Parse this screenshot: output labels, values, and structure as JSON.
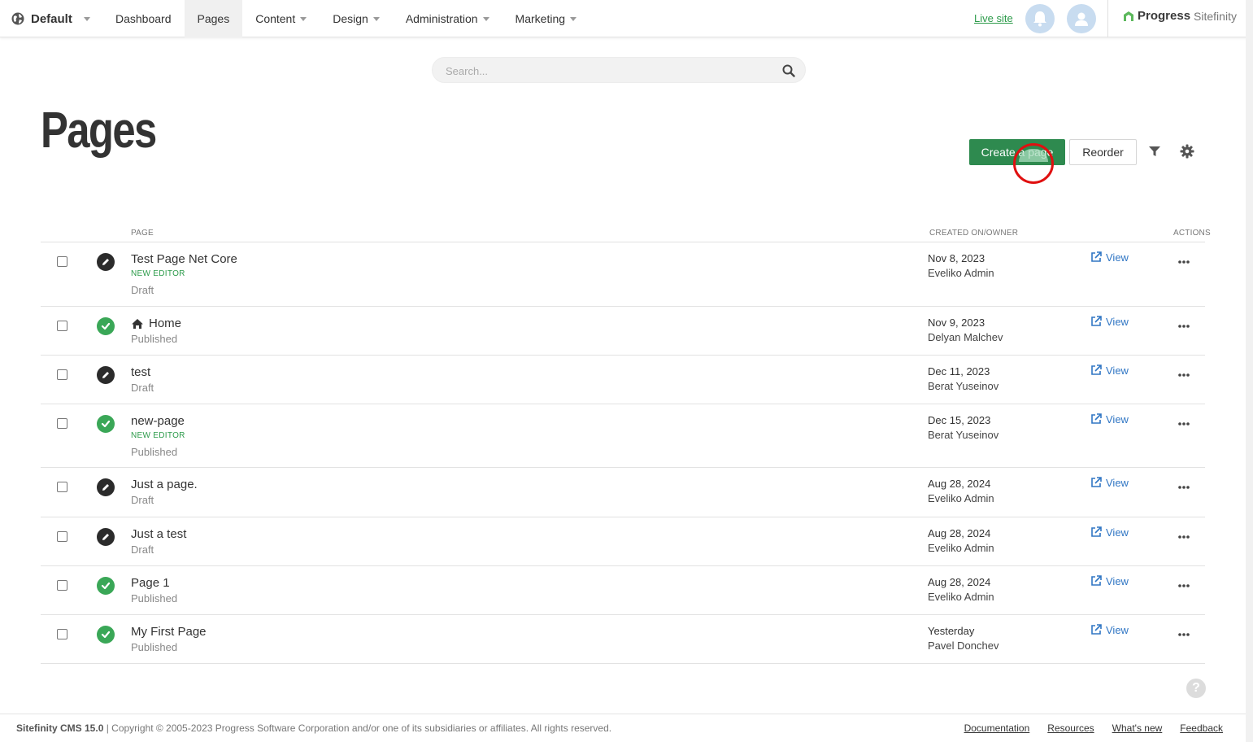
{
  "header": {
    "site_name": "Default",
    "nav": [
      "Dashboard",
      "Pages",
      "Content",
      "Design",
      "Administration",
      "Marketing"
    ],
    "active_nav": "Pages",
    "live_site": "Live site",
    "brand": {
      "progress": "Progress",
      "sitefinity": "Sitefinity"
    }
  },
  "search": {
    "placeholder": "Search..."
  },
  "page_title": "Pages",
  "toolbar": {
    "create_label": "Create a page",
    "reorder_label": "Reorder"
  },
  "table": {
    "col_page": "PAGE",
    "col_created": "CREATED ON/OWNER",
    "col_actions": "ACTIONS",
    "view_label": "View",
    "rows": [
      {
        "title": "Test Page Net Core",
        "badge": "NEW EDITOR",
        "status": "Draft",
        "date": "Nov 8, 2023",
        "owner": "Eveliko Admin"
      },
      {
        "title": "Home",
        "badge": "",
        "status": "Published",
        "date": "Nov 9, 2023",
        "owner": "Delyan Malchev",
        "home": true
      },
      {
        "title": "test",
        "badge": "",
        "status": "Draft",
        "date": "Dec 11, 2023",
        "owner": "Berat Yuseinov"
      },
      {
        "title": "new-page",
        "badge": "NEW EDITOR",
        "status": "Published",
        "date": "Dec 15, 2023",
        "owner": "Berat Yuseinov"
      },
      {
        "title": "Just a page.",
        "badge": "",
        "status": "Draft",
        "date": "Aug 28, 2024",
        "owner": "Eveliko Admin"
      },
      {
        "title": "Just a test",
        "badge": "",
        "status": "Draft",
        "date": "Aug 28, 2024",
        "owner": "Eveliko Admin"
      },
      {
        "title": "Page 1",
        "badge": "",
        "status": "Published",
        "date": "Aug 28, 2024",
        "owner": "Eveliko Admin"
      },
      {
        "title": "My First Page",
        "badge": "",
        "status": "Published",
        "date": "Yesterday",
        "owner": "Pavel Donchev"
      }
    ]
  },
  "footer": {
    "product": "Sitefinity CMS 15.0",
    "copyright": "| Copyright © 2005-2023 Progress Software Corporation and/or one of its subsidiaries or affiliates. All rights reserved.",
    "links": [
      "Documentation",
      "Resources",
      "What's new",
      "Feedback"
    ]
  },
  "colors": {
    "primary_green": "#2e8a4f",
    "link_blue": "#3076c4",
    "published_green": "#3aa757",
    "draft_dark": "#2b2b2b"
  },
  "icons": [
    "globe-icon",
    "bell-icon",
    "user-icon",
    "search-icon",
    "filter-icon",
    "gear-icon",
    "pencil-icon",
    "check-icon",
    "home-icon",
    "external-link-icon",
    "more-icon",
    "help-icon"
  ]
}
